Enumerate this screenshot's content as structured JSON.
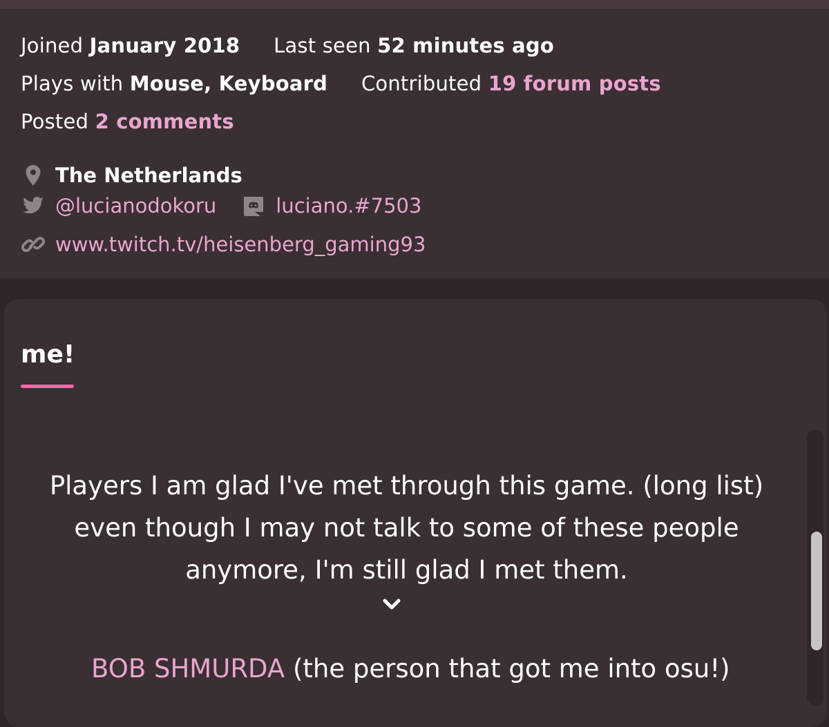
{
  "profile": {
    "joined_label": "Joined",
    "joined_value": "January 2018",
    "last_seen_label": "Last seen",
    "last_seen_value": "52 minutes ago",
    "plays_with_label": "Plays with",
    "plays_with_value": "Mouse, Keyboard",
    "contributed_label": "Contributed",
    "contributed_value": "19 forum posts",
    "posted_label": "Posted",
    "posted_value": "2 comments",
    "location": "The Netherlands",
    "twitter": "@lucianodokoru",
    "discord": "luciano.#7503",
    "website": "www.twitch.tv/heisenberg_gaming93"
  },
  "me_section": {
    "title": "me!",
    "intro_line1": "Players I am glad I've met through this game. (long list)",
    "intro_line2": "even though I may not talk to some of these people",
    "intro_line3": "anymore, I'm still glad I met them.",
    "first_item_name": "BOB SHMURDA",
    "first_item_note": " (the person that got me into osu!)"
  },
  "colors": {
    "link_pink": "#e9a5cf",
    "accent_pink": "#ff66aa",
    "panel_bg": "#3a2f33",
    "page_bg": "#2e2629"
  },
  "icons": [
    "map-marker-icon",
    "twitter-icon",
    "discord-icon",
    "link-icon",
    "chevron-down-icon"
  ]
}
